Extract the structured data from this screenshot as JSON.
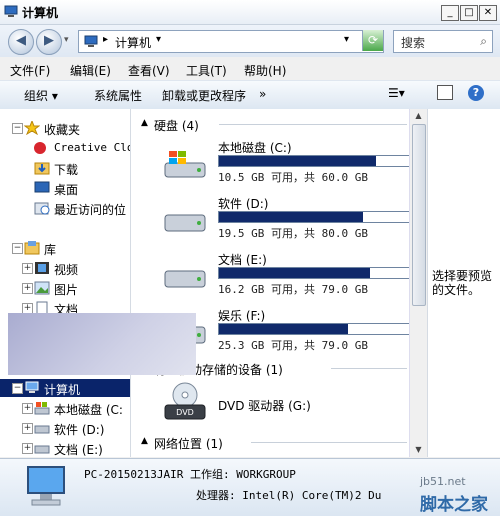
{
  "window": {
    "title": "计算机"
  },
  "address": {
    "path": "计算机",
    "separator": "▸",
    "dropdown": "▾"
  },
  "search": {
    "placeholder": "搜索"
  },
  "menu": [
    "文件(F)",
    "编辑(E)",
    "查看(V)",
    "工具(T)",
    "帮助(H)"
  ],
  "toolbar": {
    "organize": "组织",
    "system_props": "系统属性",
    "uninstall": "卸载或更改程序",
    "more": "»"
  },
  "nav": {
    "favorites": "收藏夹",
    "fav_items": [
      "Creative Clo",
      "下载",
      "桌面",
      "最近访问的位"
    ],
    "library": "库",
    "lib_items": [
      "视频",
      "图片",
      "文档"
    ],
    "computer": "计算机",
    "comp_items": [
      "本地磁盘 (C:",
      "软件 (D:)",
      "文档 (E:)"
    ]
  },
  "groups": {
    "hdd": "硬盘 (4)",
    "removable": "有可移动存储的设备 (1)",
    "network": "网络位置 (1)"
  },
  "drives": [
    {
      "name": "本地磁盘 (C:)",
      "info": "10.5 GB 可用，共 60.0 GB",
      "used_fraction": 0.825
    },
    {
      "name": "软件 (D:)",
      "info": "19.5 GB 可用，共 80.0 GB",
      "used_fraction": 0.756
    },
    {
      "name": "文档 (E:)",
      "info": "16.2 GB 可用，共 79.0 GB",
      "used_fraction": 0.795
    },
    {
      "name": "娱乐 (F:)",
      "info": "25.3 GB 可用，共 79.0 GB",
      "used_fraction": 0.68
    }
  ],
  "dvd": {
    "name": "DVD 驱动器 (G:)",
    "label": "DVD"
  },
  "preview": {
    "text": "选择要预览的文件。"
  },
  "details": {
    "computer_name": "PC-20150213JAIR",
    "workgroup_label": "工作组: WORKGROUP",
    "cpu": "处理器: Intel(R) Core(TM)2 Du"
  },
  "watermark": {
    "line1": "jb51.net",
    "line2": "脚本之家"
  }
}
